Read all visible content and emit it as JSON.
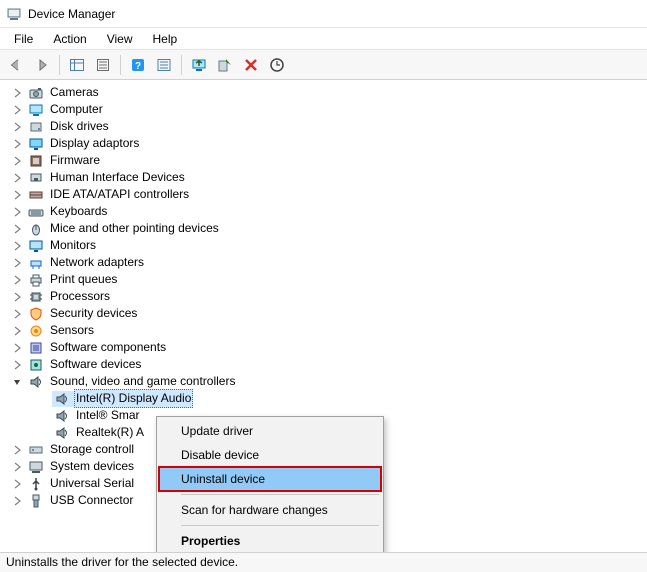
{
  "window": {
    "title": "Device Manager"
  },
  "menubar": [
    "File",
    "Action",
    "View",
    "Help"
  ],
  "toolbar": {
    "back": "back-icon",
    "forward": "forward-icon",
    "showgrid": "grid-icon",
    "properties": "properties-icon",
    "help": "help-icon",
    "list": "list-icon",
    "monitor": "monitor-icon",
    "enable": "enable-icon",
    "delete": "delete-icon",
    "refresh": "refresh-icon"
  },
  "tree": [
    {
      "label": "Cameras",
      "icon": "camera-icon"
    },
    {
      "label": "Computer",
      "icon": "computer-icon"
    },
    {
      "label": "Disk drives",
      "icon": "disk-icon"
    },
    {
      "label": "Display adaptors",
      "icon": "display-icon"
    },
    {
      "label": "Firmware",
      "icon": "firmware-icon"
    },
    {
      "label": "Human Interface Devices",
      "icon": "hid-icon"
    },
    {
      "label": "IDE ATA/ATAPI controllers",
      "icon": "ide-icon"
    },
    {
      "label": "Keyboards",
      "icon": "keyboard-icon"
    },
    {
      "label": "Mice and other pointing devices",
      "icon": "mouse-icon"
    },
    {
      "label": "Monitors",
      "icon": "monitor-icon"
    },
    {
      "label": "Network adapters",
      "icon": "network-icon"
    },
    {
      "label": "Print queues",
      "icon": "printer-icon"
    },
    {
      "label": "Processors",
      "icon": "cpu-icon"
    },
    {
      "label": "Security devices",
      "icon": "security-icon"
    },
    {
      "label": "Sensors",
      "icon": "sensor-icon"
    },
    {
      "label": "Software components",
      "icon": "swcomp-icon"
    },
    {
      "label": "Software devices",
      "icon": "swdev-icon"
    },
    {
      "label": "Sound, video and game controllers",
      "icon": "sound-icon",
      "expanded": true,
      "children": [
        {
          "label": "Intel(R) Display Audio",
          "icon": "sound-icon",
          "selected": true
        },
        {
          "label": "Intel® Smar",
          "icon": "sound-icon"
        },
        {
          "label": "Realtek(R) A",
          "icon": "sound-icon"
        }
      ]
    },
    {
      "label": "Storage controll",
      "icon": "storage-icon"
    },
    {
      "label": "System devices",
      "icon": "system-icon"
    },
    {
      "label": "Universal Serial",
      "icon": "usb-icon"
    },
    {
      "label": "USB Connector",
      "icon": "usbconn-icon"
    }
  ],
  "context_menu": {
    "items": [
      {
        "label": "Update driver"
      },
      {
        "label": "Disable device"
      },
      {
        "label": "Uninstall device",
        "highlighted": true,
        "redbox": true
      },
      {
        "separator": true
      },
      {
        "label": "Scan for hardware changes"
      },
      {
        "separator": true
      },
      {
        "label": "Properties",
        "bold": true
      }
    ]
  },
  "statusbar": "Uninstalls the driver for the selected device."
}
